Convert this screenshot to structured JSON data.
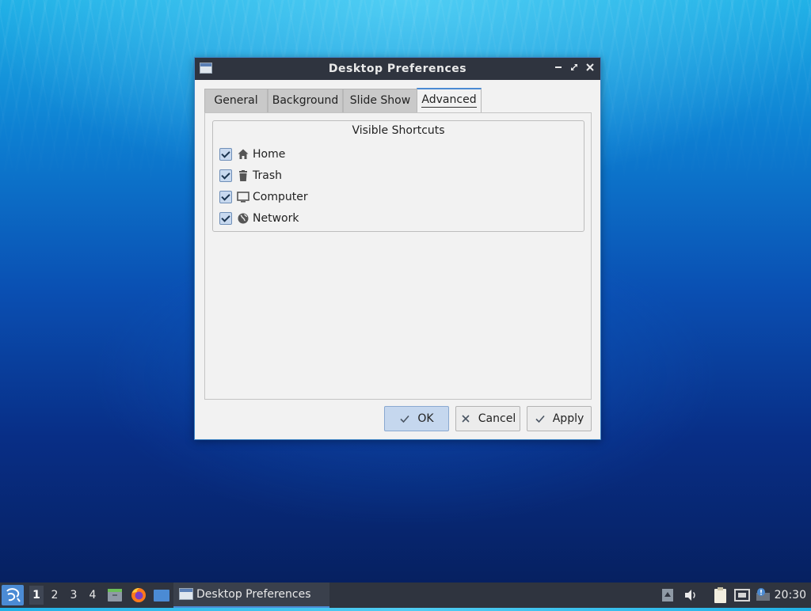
{
  "window": {
    "title": "Desktop Preferences",
    "tabs": [
      {
        "label": "General"
      },
      {
        "label": "Background"
      },
      {
        "label": "Slide Show"
      },
      {
        "label": "Advanced"
      }
    ],
    "active_tab": "Advanced",
    "group_title": "Visible Shortcuts",
    "shortcuts": [
      {
        "label": "Home",
        "icon": "home-icon",
        "checked": true
      },
      {
        "label": "Trash",
        "icon": "trash-icon",
        "checked": true
      },
      {
        "label": "Computer",
        "icon": "computer-icon",
        "checked": true
      },
      {
        "label": "Network",
        "icon": "network-globe-icon",
        "checked": true
      }
    ],
    "buttons": {
      "ok": "OK",
      "cancel": "Cancel",
      "apply": "Apply"
    }
  },
  "taskbar": {
    "desktops": [
      "1",
      "2",
      "3",
      "4"
    ],
    "active_desktop": "1",
    "task_label": "Desktop Preferences",
    "clock": "20:30"
  },
  "colors": {
    "accent": "#4b8bd4",
    "titlebar": "#2f343f",
    "panel_bg": "#f2f2f2"
  }
}
